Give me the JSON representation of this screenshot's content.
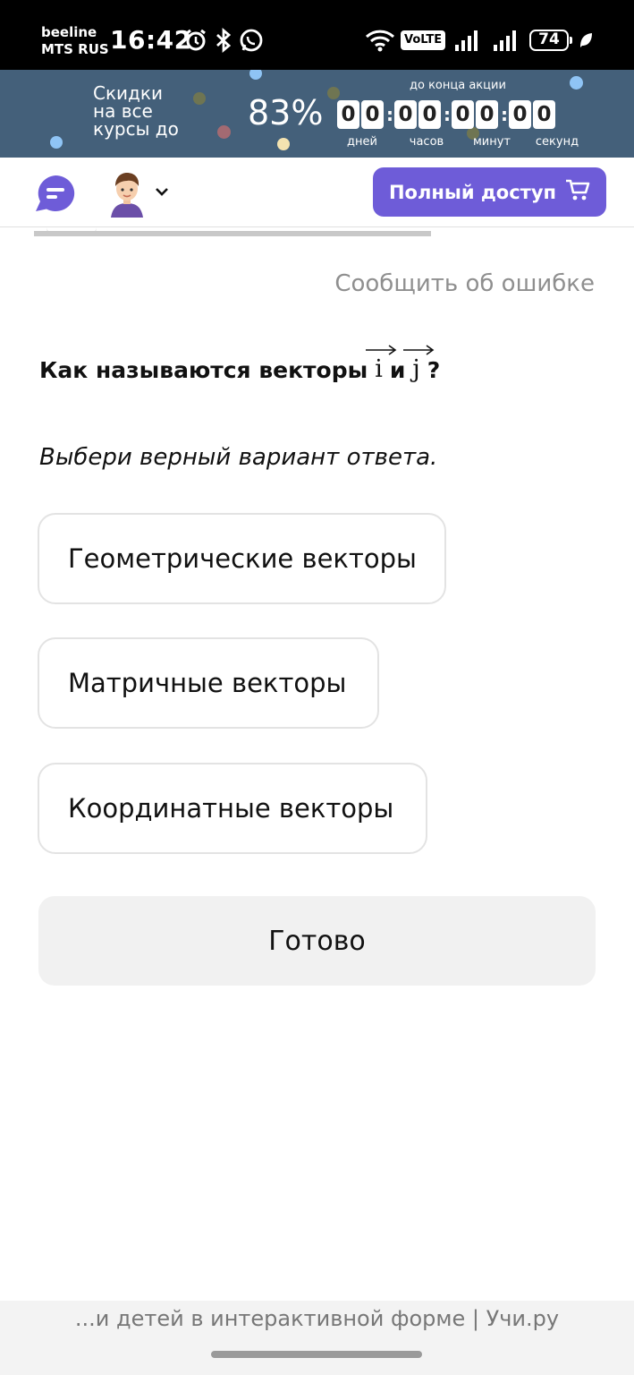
{
  "status_bar": {
    "carrier_1": "beeline",
    "carrier_2": "MTS RUS",
    "time": "16:42",
    "volte": "VoLTE",
    "volte_sub": "1",
    "battery": "74",
    "icons": [
      "alarm-icon",
      "bluetooth-icon",
      "whatsapp-icon",
      "wifi-icon",
      "signal-icon",
      "signal-icon",
      "battery-icon",
      "leaf-icon"
    ]
  },
  "promo": {
    "text_line1": "Скидки",
    "text_line2": "на все",
    "text_line3": "курсы до",
    "percent": "83%",
    "deadline": "до конца акции",
    "days": [
      "0",
      "0"
    ],
    "hours": [
      "0",
      "0"
    ],
    "minutes": [
      "0",
      "0"
    ],
    "seconds": [
      "0",
      "0"
    ],
    "label_days": "дней",
    "label_hours": "часов",
    "label_minutes": "минут",
    "label_seconds": "секунд",
    "background_color": "#44607a"
  },
  "header": {
    "buy_label": "Полный доступ",
    "accent_color": "#6e5cd8"
  },
  "task": {
    "report_link": "Сообщить об ошибке",
    "question_prefix": "Как называются векторы",
    "vector_i": "i",
    "conjunction": "и",
    "vector_j": "j",
    "question_suffix": "?",
    "instruction": "Выбери верный вариант ответа.",
    "options": [
      "Геометрические векторы",
      "Матричные векторы",
      "Координатные векторы"
    ],
    "done_label": "Готово"
  },
  "footer": {
    "text": "...и детей в интерактивной форме | Учи.ру"
  }
}
